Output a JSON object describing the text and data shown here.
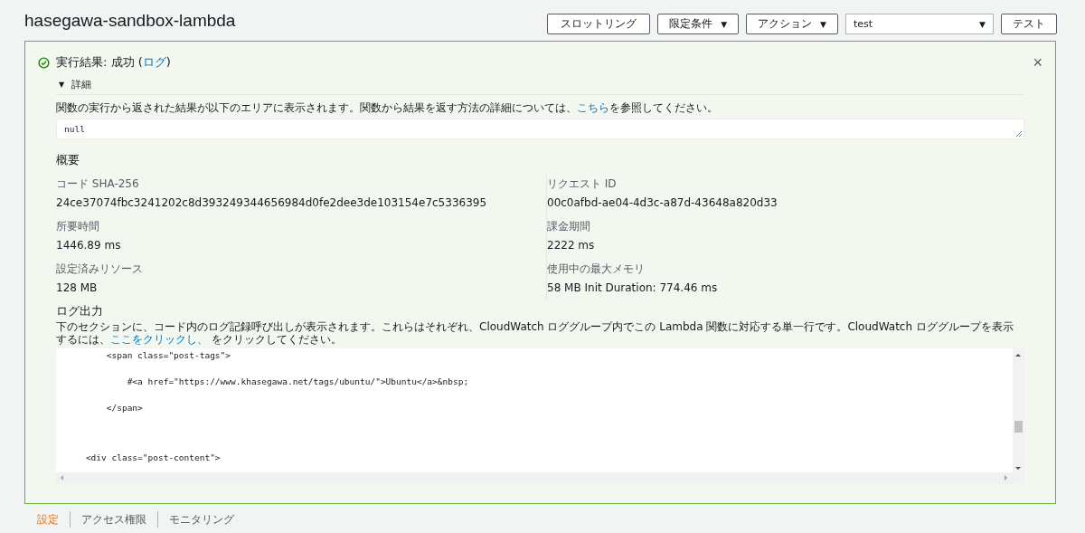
{
  "title": "hasegawa-sandbox-lambda",
  "toolbar": [
    {
      "kind": "button",
      "label": "スロットリング"
    },
    {
      "kind": "dropdown",
      "label": "限定条件",
      "caret": "▼"
    },
    {
      "kind": "dropdown",
      "label": "アクション",
      "caret": "▼"
    },
    {
      "kind": "select",
      "label": "test",
      "caret": "▼"
    },
    {
      "kind": "button",
      "label": "テスト"
    }
  ],
  "result": {
    "succeeded": true,
    "heading": "実行結果: 成功 (",
    "link": "ログ",
    "heading_end": ")",
    "close": "×",
    "details": {
      "toggle": "▼",
      "label": "詳細",
      "expanded": true,
      "description": "関数の実行から返された結果が以下のエリアに表示されます。関数から結果を返す方法の詳細については、",
      "description_link": "こちら",
      "description_end": "を参照してください。",
      "output": "null",
      "summary_title": "概要",
      "summary": [
        {
          "label": "コード SHA-256",
          "value": "24ce37074fbc3241202c8d393249344656984d0fe2dee3de103154e7c5336395"
        },
        {
          "label": "リクエスト ID",
          "value": "00c0afbd-ae04-4d3c-a87d-43648a820d33"
        },
        {
          "label": "所要時間",
          "value": "1446.89 ms"
        },
        {
          "label": "課金期間",
          "value": "2222 ms"
        },
        {
          "label": "設定済みリソース",
          "value": "128 MB"
        },
        {
          "label": "使用中の最大メモリ",
          "value": "58 MB Init Duration: 774.46 ms"
        }
      ],
      "log_title": "ログ出力",
      "log_description": "下のセクションに、コード内のログ記録呼び出しが表示されます。これらはそれぞれ、CloudWatch ロググループ内でこの Lambda 関数に対応する単一行です。CloudWatch ロググループを表示するには、",
      "log_link": "ここをクリックし、",
      "log_description_end": " をクリックしてください。",
      "log_lines": [
        "        <span class=\"post-tags\">",
        "            #<a href=\"https://www.khasegawa.net/tags/ubuntu/\">Ubuntu</a>&nbsp;",
        "        </span>",
        "    <div class=\"post-content\">"
      ]
    }
  },
  "tabs": [
    {
      "label": "設定",
      "selected": true
    },
    {
      "label": "アクセス権限",
      "selected": false
    },
    {
      "label": "モニタリング",
      "selected": false
    }
  ]
}
